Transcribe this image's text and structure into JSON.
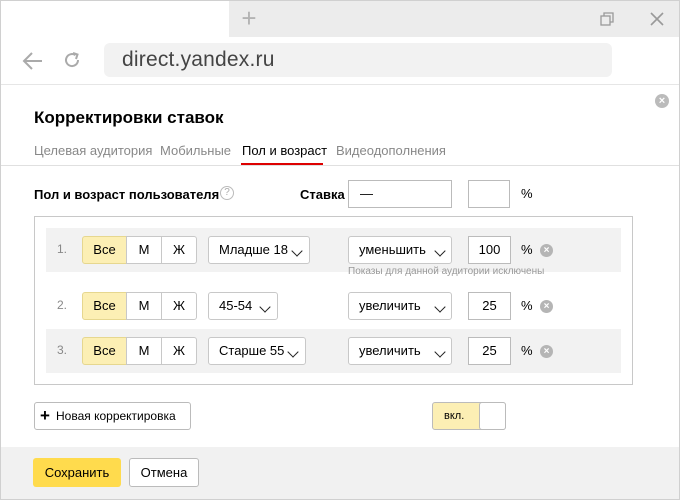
{
  "browser": {
    "url": "direct.yandex.ru",
    "new_tab_glyph": "+"
  },
  "dialog": {
    "title": "Корректировки ставок",
    "close_glyph": "×",
    "tabs": [
      {
        "label": "Целевая аудитория",
        "active": false
      },
      {
        "label": "Мобильные",
        "active": false
      },
      {
        "label": "Пол и возраст",
        "active": true
      },
      {
        "label": "Видеодополнения",
        "active": false
      }
    ],
    "section_label": "Пол и возраст пользователя",
    "help_glyph": "?",
    "rate_label": "Ставка",
    "rate_value": "—",
    "percent_value": "",
    "percent_sign": "%",
    "rows": [
      {
        "num": "1.",
        "gender": [
          "Все",
          "М",
          "Ж"
        ],
        "gender_selected": "Все",
        "age": "Младше 18",
        "action": "уменьшить",
        "value": "100",
        "pct": "%",
        "note": "Показы для данной аудитории исключены"
      },
      {
        "num": "2.",
        "gender": [
          "Все",
          "М",
          "Ж"
        ],
        "gender_selected": "Все",
        "age": "45-54",
        "action": "увеличить",
        "value": "25",
        "pct": "%",
        "note": ""
      },
      {
        "num": "3.",
        "gender": [
          "Все",
          "М",
          "Ж"
        ],
        "gender_selected": "Все",
        "age": "Старше 55",
        "action": "увеличить",
        "value": "25",
        "pct": "%",
        "note": ""
      }
    ],
    "delete_glyph": "×",
    "add_label": "Новая корректировка",
    "add_glyph": "+",
    "toggle_label": "вкл.",
    "toggle_on": true,
    "save_label": "Сохранить",
    "cancel_label": "Отмена"
  },
  "colors": {
    "accent_yellow": "#ffdb4d",
    "selected_segment": "#fcefb4",
    "active_tab_underline": "#dd0000"
  }
}
